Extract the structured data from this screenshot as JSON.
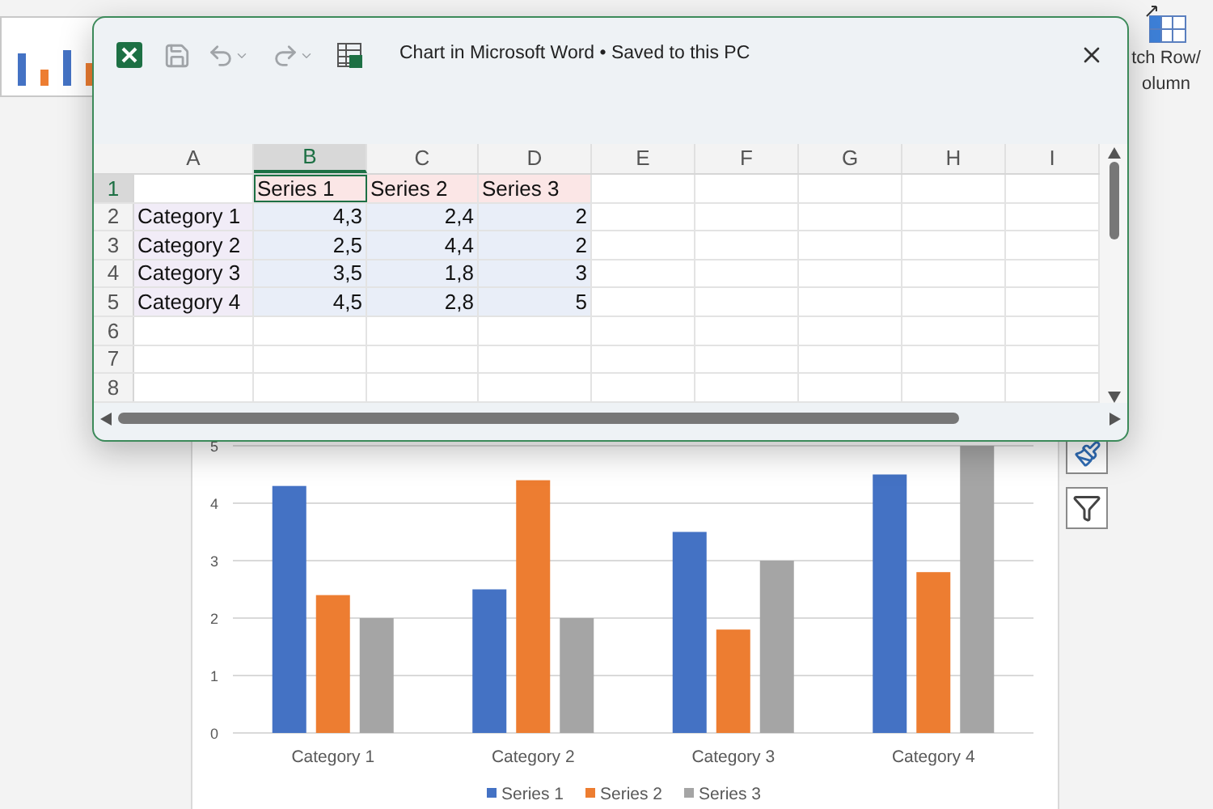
{
  "window": {
    "title": "Chart in Microsoft Word • Saved to this PC"
  },
  "ribbon": {
    "switch_label_lines": [
      "tch Row/",
      "olumn"
    ]
  },
  "sheet": {
    "columns": [
      {
        "label": "A",
        "selected": false
      },
      {
        "label": "B",
        "selected": true
      },
      {
        "label": "C",
        "selected": false
      },
      {
        "label": "D",
        "selected": false
      },
      {
        "label": "E",
        "selected": false
      },
      {
        "label": "F",
        "selected": false
      },
      {
        "label": "G",
        "selected": false
      },
      {
        "label": "H",
        "selected": false
      },
      {
        "label": "I",
        "selected": false
      }
    ],
    "rows": [
      {
        "label": "1",
        "selected": true,
        "cells": [
          {
            "kind": "empty"
          },
          {
            "kind": "series",
            "text": "Series 1"
          },
          {
            "kind": "series",
            "text": "Series 2"
          },
          {
            "kind": "series",
            "text": "Series 3"
          }
        ]
      },
      {
        "label": "2",
        "selected": false,
        "cells": [
          {
            "kind": "category",
            "text": "Category 1"
          },
          {
            "kind": "value",
            "text": "4,3"
          },
          {
            "kind": "value",
            "text": "2,4"
          },
          {
            "kind": "value",
            "text": "2"
          }
        ]
      },
      {
        "label": "3",
        "selected": false,
        "cells": [
          {
            "kind": "category",
            "text": "Category 2"
          },
          {
            "kind": "value",
            "text": "2,5"
          },
          {
            "kind": "value",
            "text": "4,4"
          },
          {
            "kind": "value",
            "text": "2"
          }
        ]
      },
      {
        "label": "4",
        "selected": false,
        "cells": [
          {
            "kind": "category",
            "text": "Category 3"
          },
          {
            "kind": "value",
            "text": "3,5"
          },
          {
            "kind": "value",
            "text": "1,8"
          },
          {
            "kind": "value",
            "text": "3"
          }
        ]
      },
      {
        "label": "5",
        "selected": false,
        "cells": [
          {
            "kind": "category",
            "text": "Category 4"
          },
          {
            "kind": "value",
            "text": "4,5"
          },
          {
            "kind": "value",
            "text": "2,8"
          },
          {
            "kind": "value",
            "text": "5"
          }
        ]
      },
      {
        "label": "6",
        "selected": false
      },
      {
        "label": "7",
        "selected": false
      },
      {
        "label": "8",
        "selected": false
      }
    ]
  },
  "chart": {
    "chart_data": {
      "type": "bar",
      "grid": true,
      "legend": true,
      "categories": [
        "Category 1",
        "Category 2",
        "Category 3",
        "Category 4"
      ],
      "ylim": [
        0,
        5
      ],
      "yticks": [
        0,
        1,
        2,
        3,
        4,
        5
      ],
      "series": [
        {
          "name": "Series 1",
          "color": "#4472c4",
          "values": [
            4.3,
            2.5,
            3.5,
            4.5
          ]
        },
        {
          "name": "Series 2",
          "color": "#ed7d31",
          "values": [
            2.4,
            4.4,
            1.8,
            2.8
          ]
        },
        {
          "name": "Series 3",
          "color": "#a5a5a5",
          "values": [
            2,
            2,
            3,
            5
          ]
        }
      ]
    }
  }
}
